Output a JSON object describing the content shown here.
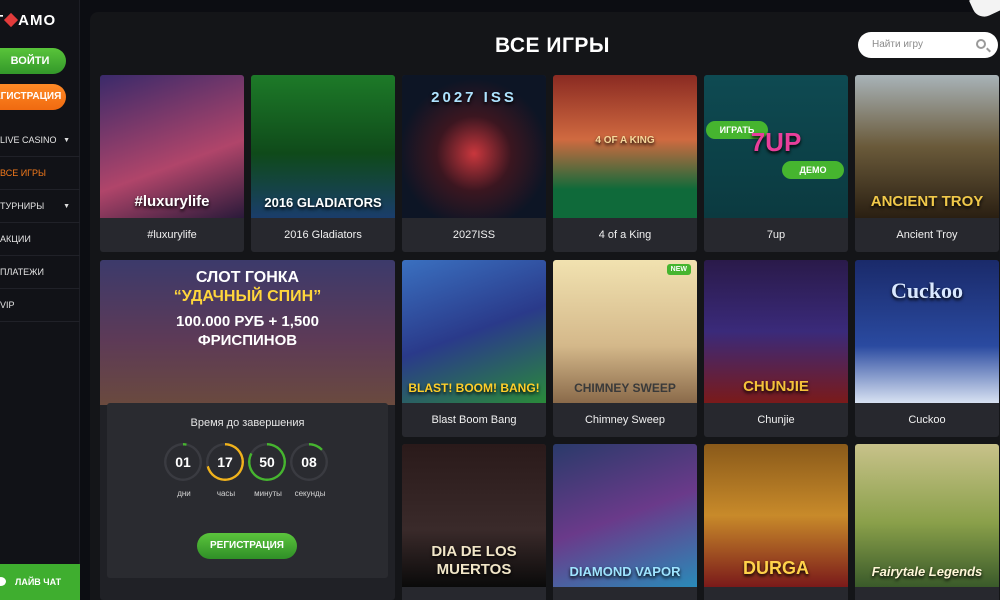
{
  "brand": {
    "logo_left": "T",
    "logo_right": "AMO"
  },
  "sidebar": {
    "login_label": "ВОЙТИ",
    "register_label": "ЕГИСТРАЦИЯ",
    "items": [
      {
        "label": "LIVE CASINO",
        "arrow": "▼"
      },
      {
        "label": "ВСЕ ИГРЫ",
        "arrow": ""
      },
      {
        "label": "ТУРНИРЫ",
        "arrow": "▼"
      },
      {
        "label": "АКЦИИ",
        "arrow": ""
      },
      {
        "label": "ПЛАТЕЖИ",
        "arrow": ""
      },
      {
        "label": "VIP",
        "arrow": ""
      }
    ],
    "chat_label": "ЛАЙВ ЧАТ"
  },
  "header": {
    "title": "ВСЕ ИГРЫ",
    "search_placeholder": "Найти игру"
  },
  "games": [
    {
      "name": "#luxurylife",
      "art": "#luxurylife"
    },
    {
      "name": "2016 Gladiators",
      "art": "2016 GLADIATORS"
    },
    {
      "name": "2027ISS",
      "art": "2027 ISS"
    },
    {
      "name": "4 of a King",
      "art": "4 OF A KING"
    },
    {
      "name": "7up",
      "art": "7UP",
      "play": "ИГРАТЬ",
      "demo": "ДЕМО"
    },
    {
      "name": "Ancient Troy",
      "art": "ANCIENT TROY"
    },
    {
      "name": "Blast Boom Bang",
      "art": "BLAST! BOOM! BANG!"
    },
    {
      "name": "Chimney Sweep",
      "art": "CHIMNEY SWEEP",
      "badge": "NEW"
    },
    {
      "name": "Chunjie",
      "art": "CHUNJIE"
    },
    {
      "name": "Cuckoo",
      "art": "Cuckoo"
    },
    {
      "name": "",
      "art": "DIA DE LOS MUERTOS"
    },
    {
      "name": "",
      "art": "DIAMOND VAPOR"
    },
    {
      "name": "",
      "art": "DURGA"
    },
    {
      "name": "",
      "art": "Fairytale Legends"
    }
  ],
  "promo": {
    "line1": "СЛОТ ГОНКА",
    "line2": "“УДАЧНЫЙ СПИН”",
    "line3": "100.000 РУБ + 1,500",
    "line4": "ФРИСПИНОВ",
    "countdown_caption": "Время до завершения",
    "units": [
      {
        "value": "01",
        "label": "дни",
        "progress": 0.03
      },
      {
        "value": "17",
        "label": "часы",
        "progress": 0.71
      },
      {
        "value": "50",
        "label": "минуты",
        "progress": 0.83
      },
      {
        "value": "08",
        "label": "секунды",
        "progress": 0.13
      }
    ],
    "register_label": "РЕГИСТРАЦИЯ"
  },
  "colors": {
    "accent_green": "#46b52f",
    "accent_orange": "#f2791b",
    "ring_yellow": "#f0b21c",
    "ring_green": "#46b52f"
  }
}
